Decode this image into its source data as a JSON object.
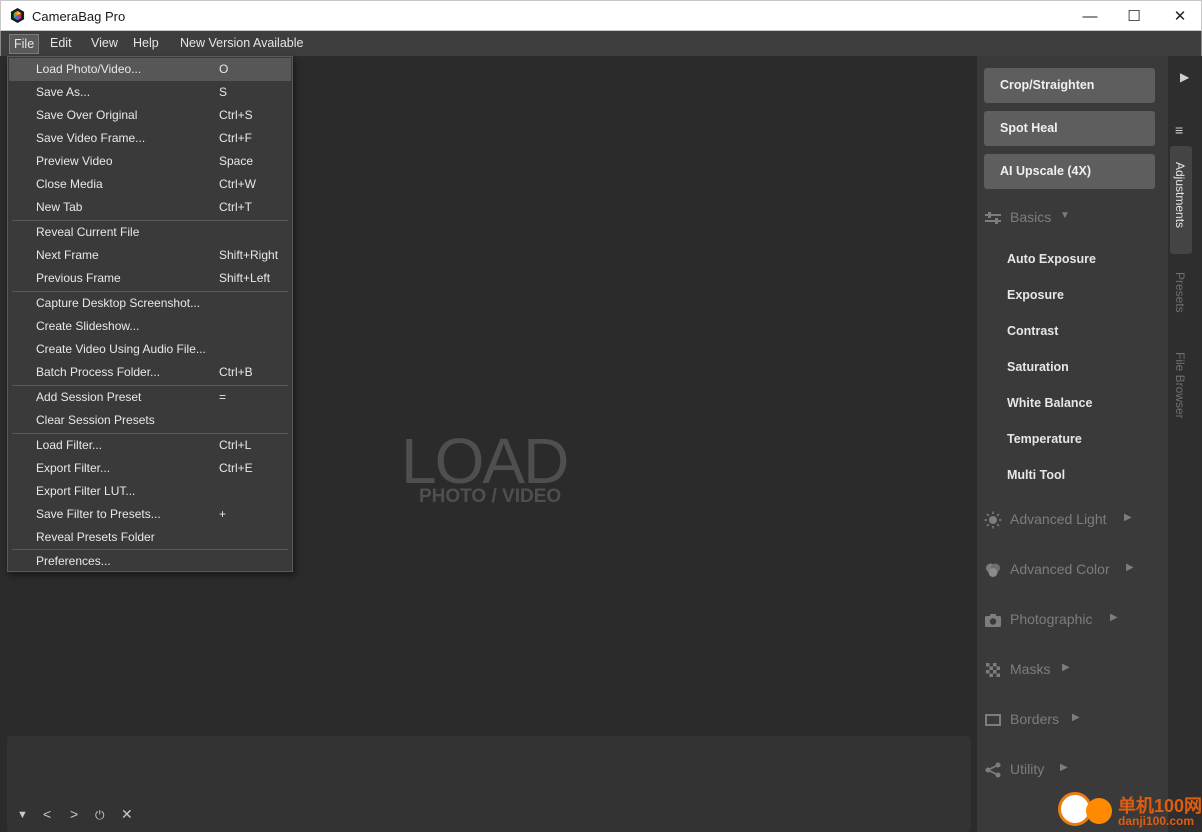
{
  "window": {
    "title": "CameraBag Pro",
    "minimize": "—",
    "maximize": "☐",
    "close": "✕"
  },
  "menubar": {
    "items": [
      {
        "label": "File"
      },
      {
        "label": "Edit"
      },
      {
        "label": "View"
      },
      {
        "label": "Help"
      },
      {
        "label": "New Version Available"
      }
    ]
  },
  "file_menu": {
    "items": [
      {
        "label": "Load Photo/Video...",
        "shortcut": "O",
        "highlighted": true
      },
      {
        "label": "Save As...",
        "shortcut": "S"
      },
      {
        "label": "Save Over Original",
        "shortcut": "Ctrl+S"
      },
      {
        "label": "Save Video Frame...",
        "shortcut": "Ctrl+F"
      },
      {
        "label": "Preview Video",
        "shortcut": "Space"
      },
      {
        "label": "Close Media",
        "shortcut": "Ctrl+W"
      },
      {
        "label": "New Tab",
        "shortcut": "Ctrl+T"
      },
      {
        "label": "Reveal Current File",
        "shortcut": ""
      },
      {
        "label": "Next Frame",
        "shortcut": "Shift+Right"
      },
      {
        "label": "Previous Frame",
        "shortcut": "Shift+Left"
      },
      {
        "label": "Capture Desktop Screenshot...",
        "shortcut": ""
      },
      {
        "label": "Create Slideshow...",
        "shortcut": ""
      },
      {
        "label": "Create Video Using Audio File...",
        "shortcut": ""
      },
      {
        "label": "Batch Process Folder...",
        "shortcut": "Ctrl+B"
      },
      {
        "label": "Add Session Preset",
        "shortcut": "="
      },
      {
        "label": "Clear Session Presets",
        "shortcut": ""
      },
      {
        "label": "Load Filter...",
        "shortcut": "Ctrl+L"
      },
      {
        "label": "Export Filter...",
        "shortcut": "Ctrl+E"
      },
      {
        "label": "Export Filter LUT...",
        "shortcut": ""
      },
      {
        "label": "Save Filter to Presets...",
        "shortcut": "+"
      },
      {
        "label": "Reveal Presets Folder",
        "shortcut": ""
      },
      {
        "label": "Preferences...",
        "shortcut": ""
      }
    ]
  },
  "canvas": {
    "load_title": "LOAD",
    "load_subtitle": "PHOTO / VIDEO"
  },
  "bottom_controls": {
    "collapse": "▼",
    "prev": "<",
    "next": ">",
    "power": "⏻",
    "close": "✕"
  },
  "tools": {
    "crop": "Crop/Straighten",
    "spot_heal": "Spot Heal",
    "ai_upscale": "AI Upscale (4X)"
  },
  "sections": {
    "basics": {
      "label": "Basics",
      "icon": "sliders-icon"
    },
    "advanced_light": {
      "label": "Advanced Light",
      "icon": "sun-icon"
    },
    "advanced_color": {
      "label": "Advanced Color",
      "icon": "color-circles-icon"
    },
    "photographic": {
      "label": "Photographic",
      "icon": "camera-icon"
    },
    "masks": {
      "label": "Masks",
      "icon": "checker-icon"
    },
    "borders": {
      "label": "Borders",
      "icon": "frame-icon"
    },
    "utility": {
      "label": "Utility",
      "icon": "share-icon"
    }
  },
  "basics_items": [
    {
      "label": "Auto Exposure"
    },
    {
      "label": "Exposure"
    },
    {
      "label": "Contrast"
    },
    {
      "label": "Saturation"
    },
    {
      "label": "White Balance"
    },
    {
      "label": "Temperature"
    },
    {
      "label": "Multi Tool"
    }
  ],
  "side_tabs": {
    "adjustments": "Adjustments",
    "presets": "Presets",
    "file_browser": "File Browser",
    "arrow": "▶",
    "menu": "≡"
  },
  "watermark": {
    "text": "单机100网",
    "url": "danji100.com"
  },
  "colors": {
    "accent_watermark": "#e05d10",
    "panel_bg": "#3a3a3a",
    "canvas_bg": "#2b2b2b"
  }
}
